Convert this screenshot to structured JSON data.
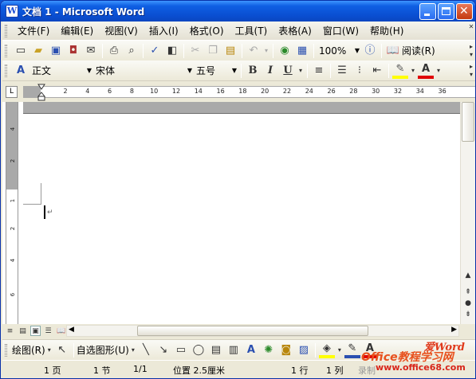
{
  "window": {
    "title": "文档 1 - Microsoft Word",
    "app_icon": "W"
  },
  "menu": [
    "文件(F)",
    "编辑(E)",
    "视图(V)",
    "插入(I)",
    "格式(O)",
    "工具(T)",
    "表格(A)",
    "窗口(W)",
    "帮助(H)"
  ],
  "toolbar": {
    "zoom": "100%",
    "read_label": "阅读(R)",
    "icons": [
      "new-doc-icon",
      "open-icon",
      "save-icon",
      "permission-icon",
      "email-icon",
      "print-icon",
      "print-preview-icon",
      "spelling-icon",
      "research-icon",
      "cut-icon",
      "copy-icon",
      "paste-icon",
      "undo-icon",
      "hyperlink-icon",
      "table-icon",
      "help-icon",
      "read-icon"
    ]
  },
  "format": {
    "style": "正文",
    "font": "宋体",
    "size": "五号",
    "bold": "B",
    "italic": "I",
    "underline": "U",
    "font_color": "#e00000",
    "highlight_color": "#ffff00"
  },
  "ruler": {
    "corner": "L",
    "h_ticks": [
      "2",
      "4",
      "6",
      "8",
      "10",
      "12",
      "14",
      "16",
      "18",
      "20",
      "22",
      "24",
      "26",
      "28",
      "30",
      "32",
      "34",
      "36"
    ],
    "v_ticks": [
      "4",
      "2",
      "1",
      "2",
      "4",
      "6"
    ]
  },
  "document": {
    "paragraph_mark": "↵"
  },
  "drawing": {
    "draw_label": "绘图(R)",
    "autoshapes_label": "自选图形(U)"
  },
  "status": {
    "page": "1 页",
    "section": "1 节",
    "pages": "1/1",
    "position": "位置 2.5厘米",
    "line": "1 行",
    "column": "1 列",
    "record": "录制"
  },
  "watermark": {
    "line1": "爱Word",
    "line2": "Office教程学习网",
    "line3": "www.office68.com"
  }
}
